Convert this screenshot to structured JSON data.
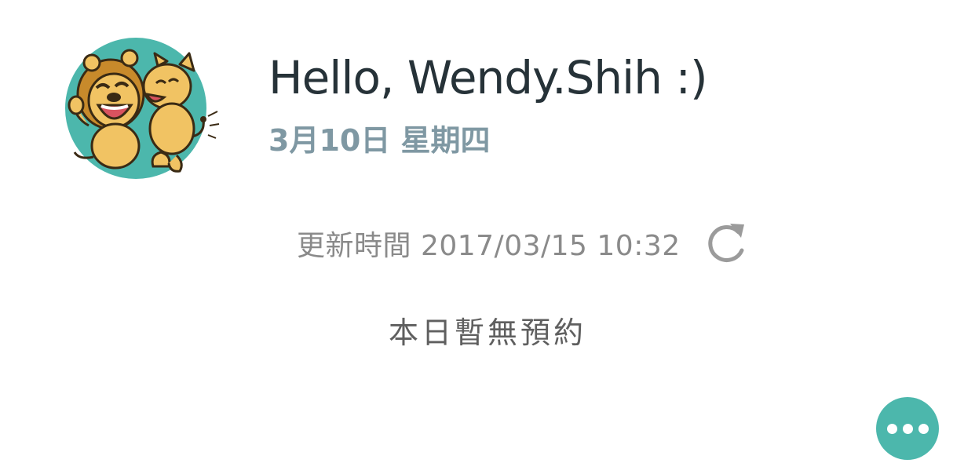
{
  "header": {
    "greeting": "Hello, Wendy.Shih :)",
    "date": "3月10日 星期四"
  },
  "avatar": {
    "icon": "lion-mascots-avatar",
    "bg_color": "#4cb7ac"
  },
  "sync": {
    "label": "更新時間 2017/03/15 10:32",
    "refresh_icon": "refresh-icon"
  },
  "appointments": {
    "empty_message": "本日暫無預約"
  },
  "fab": {
    "icon": "more-icon",
    "color": "#4cb7ac"
  },
  "colors": {
    "title": "#263238",
    "date": "#7f98a3",
    "muted": "#8a8a8a",
    "accent": "#4cb7ac"
  }
}
